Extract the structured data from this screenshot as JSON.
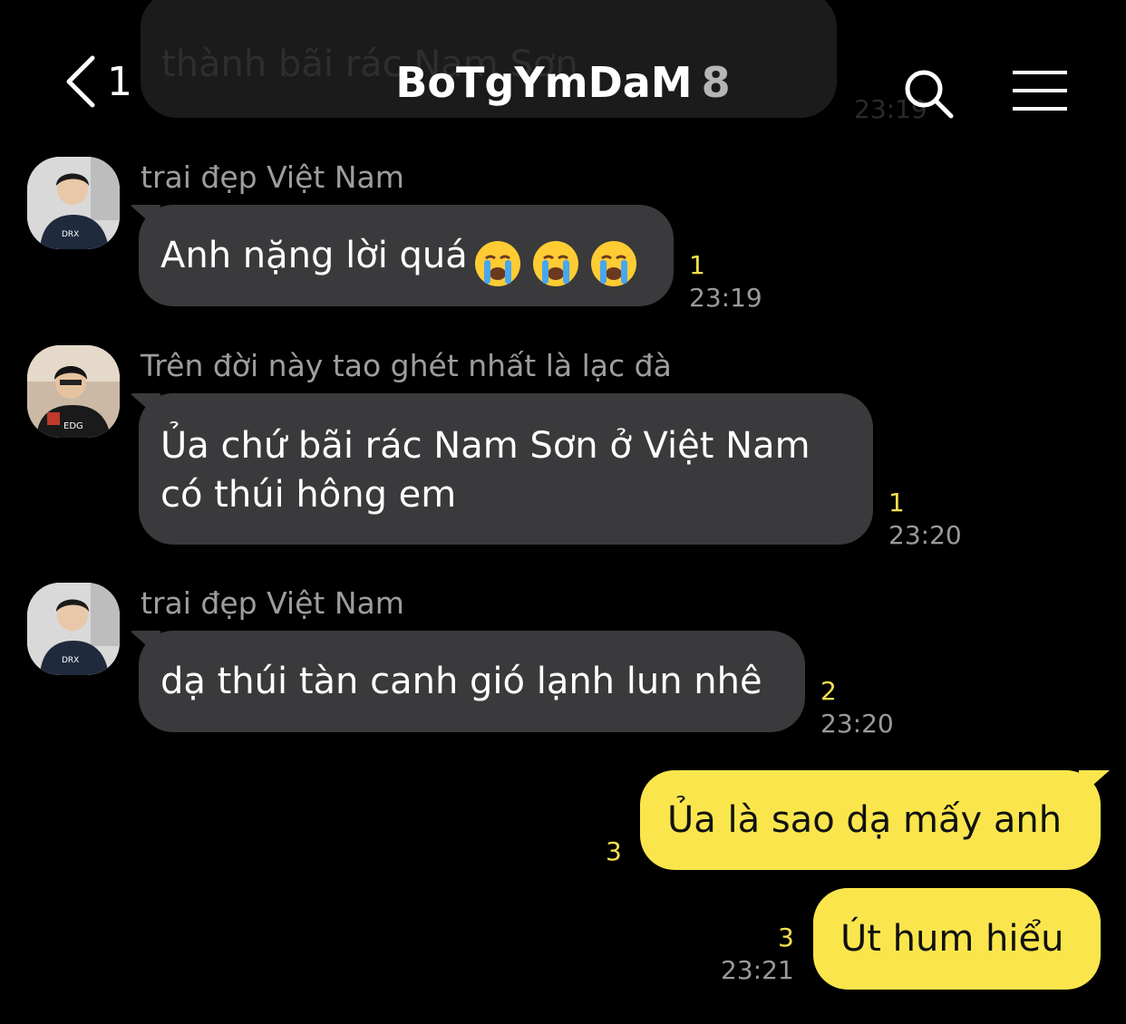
{
  "header": {
    "back_count": "1",
    "title": "BoTgYmDaM",
    "member_count": "8",
    "icons": [
      "back-chevron-icon",
      "search-icon",
      "menu-icon"
    ]
  },
  "faded_message": {
    "text": "thành bãi rác Nam Sơn",
    "time": "23:19"
  },
  "messages": [
    {
      "sender": "trai đẹp Việt Nam",
      "text": "Anh nặng lời quá",
      "emojis": [
        "crying-face-icon",
        "crying-face-icon",
        "crying-face-icon"
      ],
      "unread": "1",
      "time": "23:19"
    },
    {
      "sender": "Trên đời này tao ghét nhất là lạc đà",
      "line1": "Ủa chứ bãi rác Nam Sơn ở Việt Nam",
      "line2": "có thúi hông em",
      "unread": "1",
      "time": "23:20"
    },
    {
      "sender": "trai đẹp Việt Nam",
      "text": "dạ thúi tàn canh gió lạnh lun nhê",
      "unread": "2",
      "time": "23:20"
    }
  ],
  "outgoing": [
    {
      "text": "Ủa là sao dạ mấy anh",
      "unread": "3"
    },
    {
      "text": "Út hum hiểu",
      "unread": "3",
      "time": "23:21"
    }
  ],
  "colors": {
    "background": "#000000",
    "incoming_bubble": "#3a3a3c",
    "outgoing_bubble": "#fae64c",
    "unread_count": "#f5e24a",
    "secondary_text": "#9a9a9a"
  }
}
